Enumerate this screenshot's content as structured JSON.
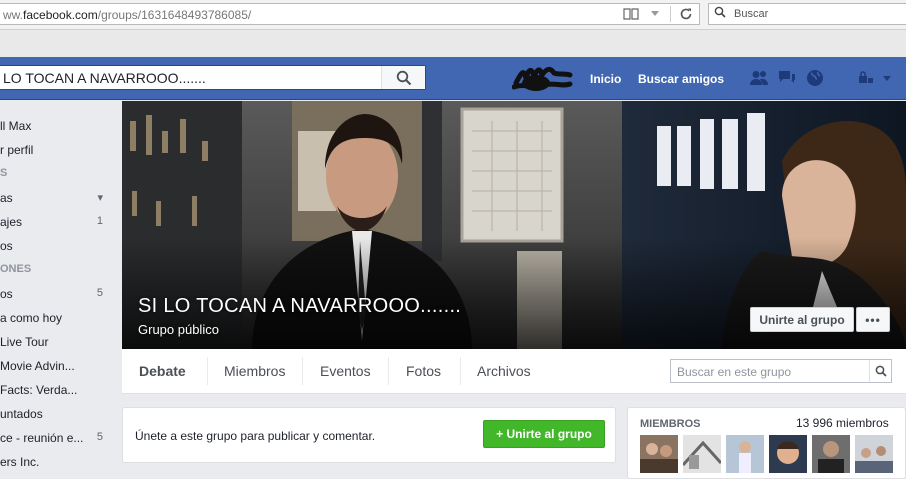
{
  "browser": {
    "url_prefix": "ww.",
    "url_domain": "facebook.com",
    "url_path": "/groups/1631648493786085/",
    "search_placeholder": "Buscar"
  },
  "topbar": {
    "search_value": "LO TOCAN A NAVARROOO.......",
    "nav_home": "Inicio",
    "nav_find_friends": "Buscar amigos"
  },
  "sidebar": {
    "items": [
      {
        "label": "ll Max",
        "count": ""
      },
      {
        "label": "r perfil",
        "count": ""
      },
      {
        "label": "S",
        "count": "",
        "header": true
      },
      {
        "label": "as",
        "count": "▾"
      },
      {
        "label": "ajes",
        "count": "1"
      },
      {
        "label": "os",
        "count": ""
      },
      {
        "label": "ONES",
        "count": "",
        "header": true
      },
      {
        "label": "os",
        "count": "5"
      },
      {
        "label": "a como hoy",
        "count": ""
      },
      {
        "label": "Live Tour",
        "count": ""
      },
      {
        "label": "Movie Advin...",
        "count": ""
      },
      {
        "label": "Facts: Verda...",
        "count": ""
      },
      {
        "label": "untados",
        "count": ""
      },
      {
        "label": "ce - reunión e...",
        "count": "5"
      },
      {
        "label": "ers Inc.",
        "count": ""
      }
    ]
  },
  "group": {
    "title": "SI LO TOCAN A NAVARROOO.......",
    "privacy": "Grupo público",
    "join_label": "Unirte al grupo",
    "more_label": "•••"
  },
  "tabs": [
    {
      "label": "Debate",
      "active": true
    },
    {
      "label": "Miembros",
      "active": false
    },
    {
      "label": "Eventos",
      "active": false
    },
    {
      "label": "Fotos",
      "active": false
    },
    {
      "label": "Archivos",
      "active": false
    }
  ],
  "group_search": {
    "placeholder": "Buscar en este grupo"
  },
  "join_card": {
    "text": "Únete a este grupo para publicar y comentar.",
    "button": "+ Unirte al grupo"
  },
  "members": {
    "heading": "MIEMBROS",
    "count": "13 996 miembros"
  },
  "colors": {
    "facebook_blue": "#4267b2",
    "green_button": "#42b72a",
    "page_bg": "#e9ebee"
  }
}
